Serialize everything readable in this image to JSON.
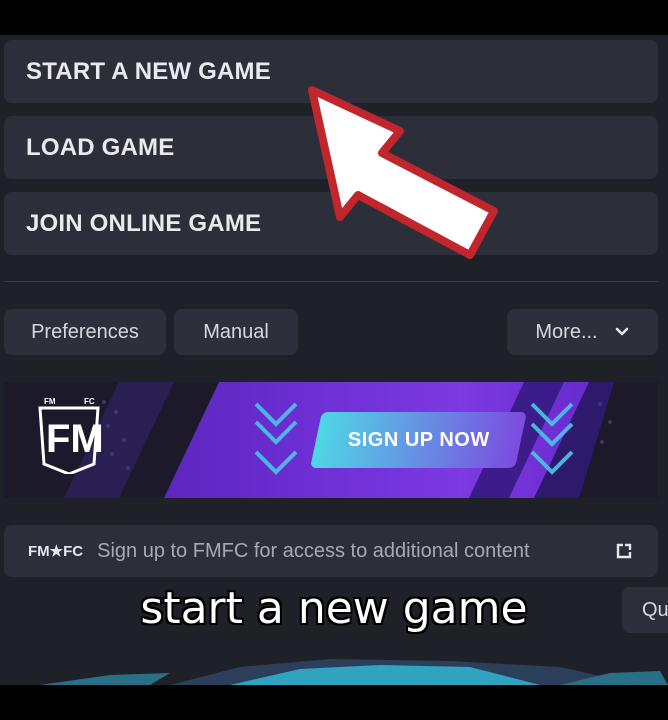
{
  "menu": {
    "start_new_game": "START A NEW GAME",
    "load_game": "LOAD GAME",
    "join_online_game": "JOIN ONLINE GAME"
  },
  "toolbar": {
    "preferences": "Preferences",
    "manual": "Manual",
    "more": "More..."
  },
  "banner": {
    "logo_text": "FM",
    "logo_small_left": "FM",
    "logo_small_right": "FC",
    "cta": "SIGN UP NOW"
  },
  "fmfc": {
    "brand": "FM★FC",
    "message": "Sign up to FMFC for access to additional content"
  },
  "partial_button": "Qu",
  "caption": "start a new game",
  "colors": {
    "background": "#1f2129",
    "button": "#2c2f3a",
    "arrow": "#c0262b",
    "accent_cyan": "#3fe0e6"
  }
}
